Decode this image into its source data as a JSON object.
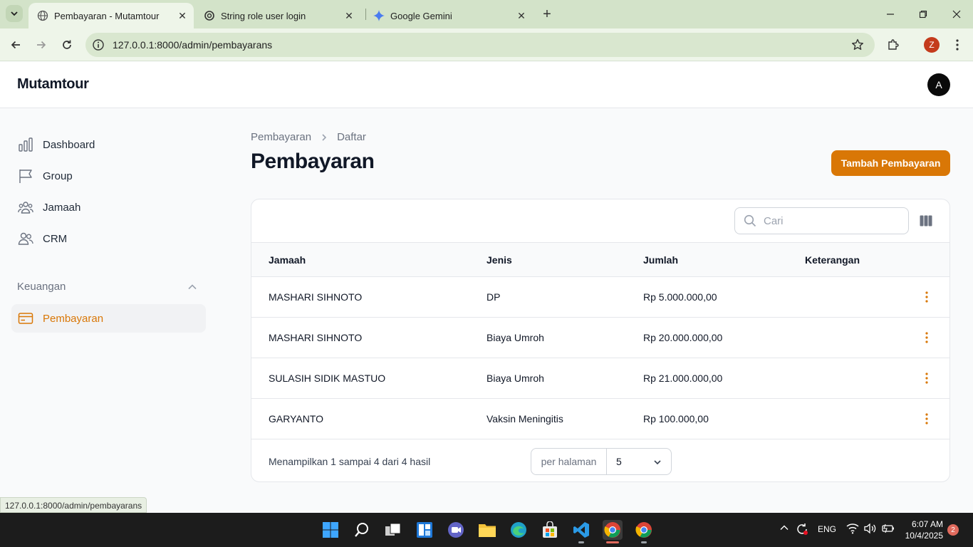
{
  "browser": {
    "tabs": [
      {
        "title": "Pembayaran - Mutamtour",
        "active": true
      },
      {
        "title": "String role user login",
        "active": false
      },
      {
        "title": "Google Gemini",
        "active": false
      }
    ],
    "url": "127.0.0.1:8000/admin/pembayarans",
    "profile_initial": "Z",
    "status_url": "127.0.0.1:8000/admin/pembayarans"
  },
  "app": {
    "brand": "Mutamtour",
    "user_initial": "A",
    "accent_color": "#d97706"
  },
  "sidebar": {
    "items": [
      {
        "label": "Dashboard",
        "icon": "chart-bar-icon"
      },
      {
        "label": "Group",
        "icon": "flag-icon"
      },
      {
        "label": "Jamaah",
        "icon": "user-group-icon"
      },
      {
        "label": "CRM",
        "icon": "users-icon"
      }
    ],
    "group_label": "Keuangan",
    "group_items": [
      {
        "label": "Pembayaran",
        "icon": "credit-card-icon",
        "active": true
      }
    ]
  },
  "main": {
    "breadcrumb": [
      "Pembayaran",
      "Daftar"
    ],
    "title": "Pembayaran",
    "create_button": "Tambah Pembayaran",
    "search_placeholder": "Cari",
    "columns": [
      "Jamaah",
      "Jenis",
      "Jumlah",
      "Keterangan"
    ],
    "rows": [
      {
        "jamaah": "MASHARI SIHNOTO",
        "jenis": "DP",
        "jumlah": "Rp 5.000.000,00",
        "keterangan": ""
      },
      {
        "jamaah": "MASHARI SIHNOTO",
        "jenis": "Biaya Umroh",
        "jumlah": "Rp 20.000.000,00",
        "keterangan": ""
      },
      {
        "jamaah": "SULASIH SIDIK MASTUO",
        "jenis": "Biaya Umroh",
        "jumlah": "Rp 21.000.000,00",
        "keterangan": ""
      },
      {
        "jamaah": "GARYANTO",
        "jenis": "Vaksin Meningitis",
        "jumlah": "Rp 100.000,00",
        "keterangan": ""
      }
    ],
    "pagination_summary": "Menampilkan 1 sampai 4 dari 4 hasil",
    "per_page_label": "per halaman",
    "per_page_value": "5"
  },
  "taskbar": {
    "language": "ENG",
    "time": "6:07 AM",
    "date": "10/4/2025",
    "notifications": "2"
  }
}
